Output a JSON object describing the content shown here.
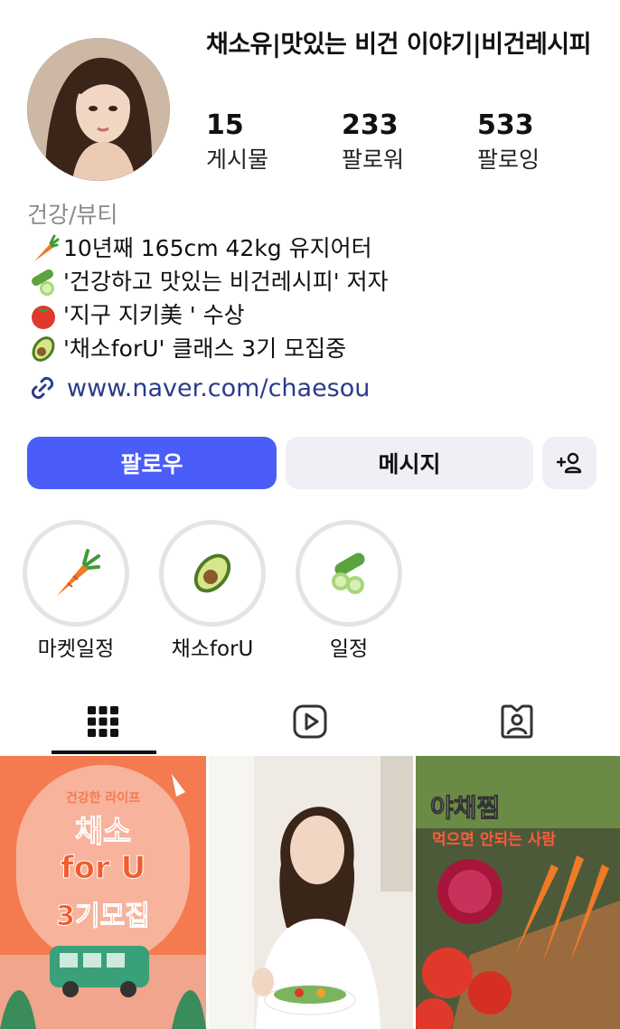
{
  "profile": {
    "name": "채소유|맛있는 비건 이야기|비건레시피",
    "stats": [
      {
        "value": "15",
        "label": "게시물"
      },
      {
        "value": "233",
        "label": "팔로워"
      },
      {
        "value": "533",
        "label": "팔로잉"
      }
    ]
  },
  "bio": {
    "category": "건강/뷰티",
    "lines": [
      {
        "icon": "carrot-icon",
        "text": "10년째 165cm 42kg 유지어터"
      },
      {
        "icon": "cucumber-icon",
        "text": "'건강하고 맛있는 비건레시피' 저자"
      },
      {
        "icon": "tomato-icon",
        "text": "'지구 지키美 ' 수상"
      },
      {
        "icon": "avocado-icon",
        "text": "'채소forU' 클래스 3기 모집중"
      }
    ],
    "link": "www.naver.com/chaesou"
  },
  "actions": {
    "follow": "팔로우",
    "message": "메시지",
    "add_user": "+8"
  },
  "highlights": [
    {
      "label": "마켓일정",
      "icon": "carrot-icon"
    },
    {
      "label": "채소forU",
      "icon": "avocado-icon"
    },
    {
      "label": "일정",
      "icon": "cucumber-icon"
    }
  ],
  "tabs": [
    {
      "name": "grid",
      "icon": "grid-icon",
      "active": true
    },
    {
      "name": "reels",
      "icon": "reels-icon",
      "active": false
    },
    {
      "name": "tagged",
      "icon": "tagged-icon",
      "active": false
    }
  ],
  "posts": [
    {
      "small": "건강한 라이프",
      "title1": "채소",
      "title2": "for U",
      "title3": "3기모집",
      "bg": "#f47b4f"
    },
    {
      "bg": "#f0ece6"
    },
    {
      "title": "야채찜",
      "subtitle": "먹으면 안되는 사람",
      "bg": "#5a4a3a"
    }
  ],
  "colors": {
    "accent": "#4a5df9",
    "button_bg": "#eef0f5",
    "link": "#2b3b8c",
    "muted": "#8a8a8a"
  }
}
